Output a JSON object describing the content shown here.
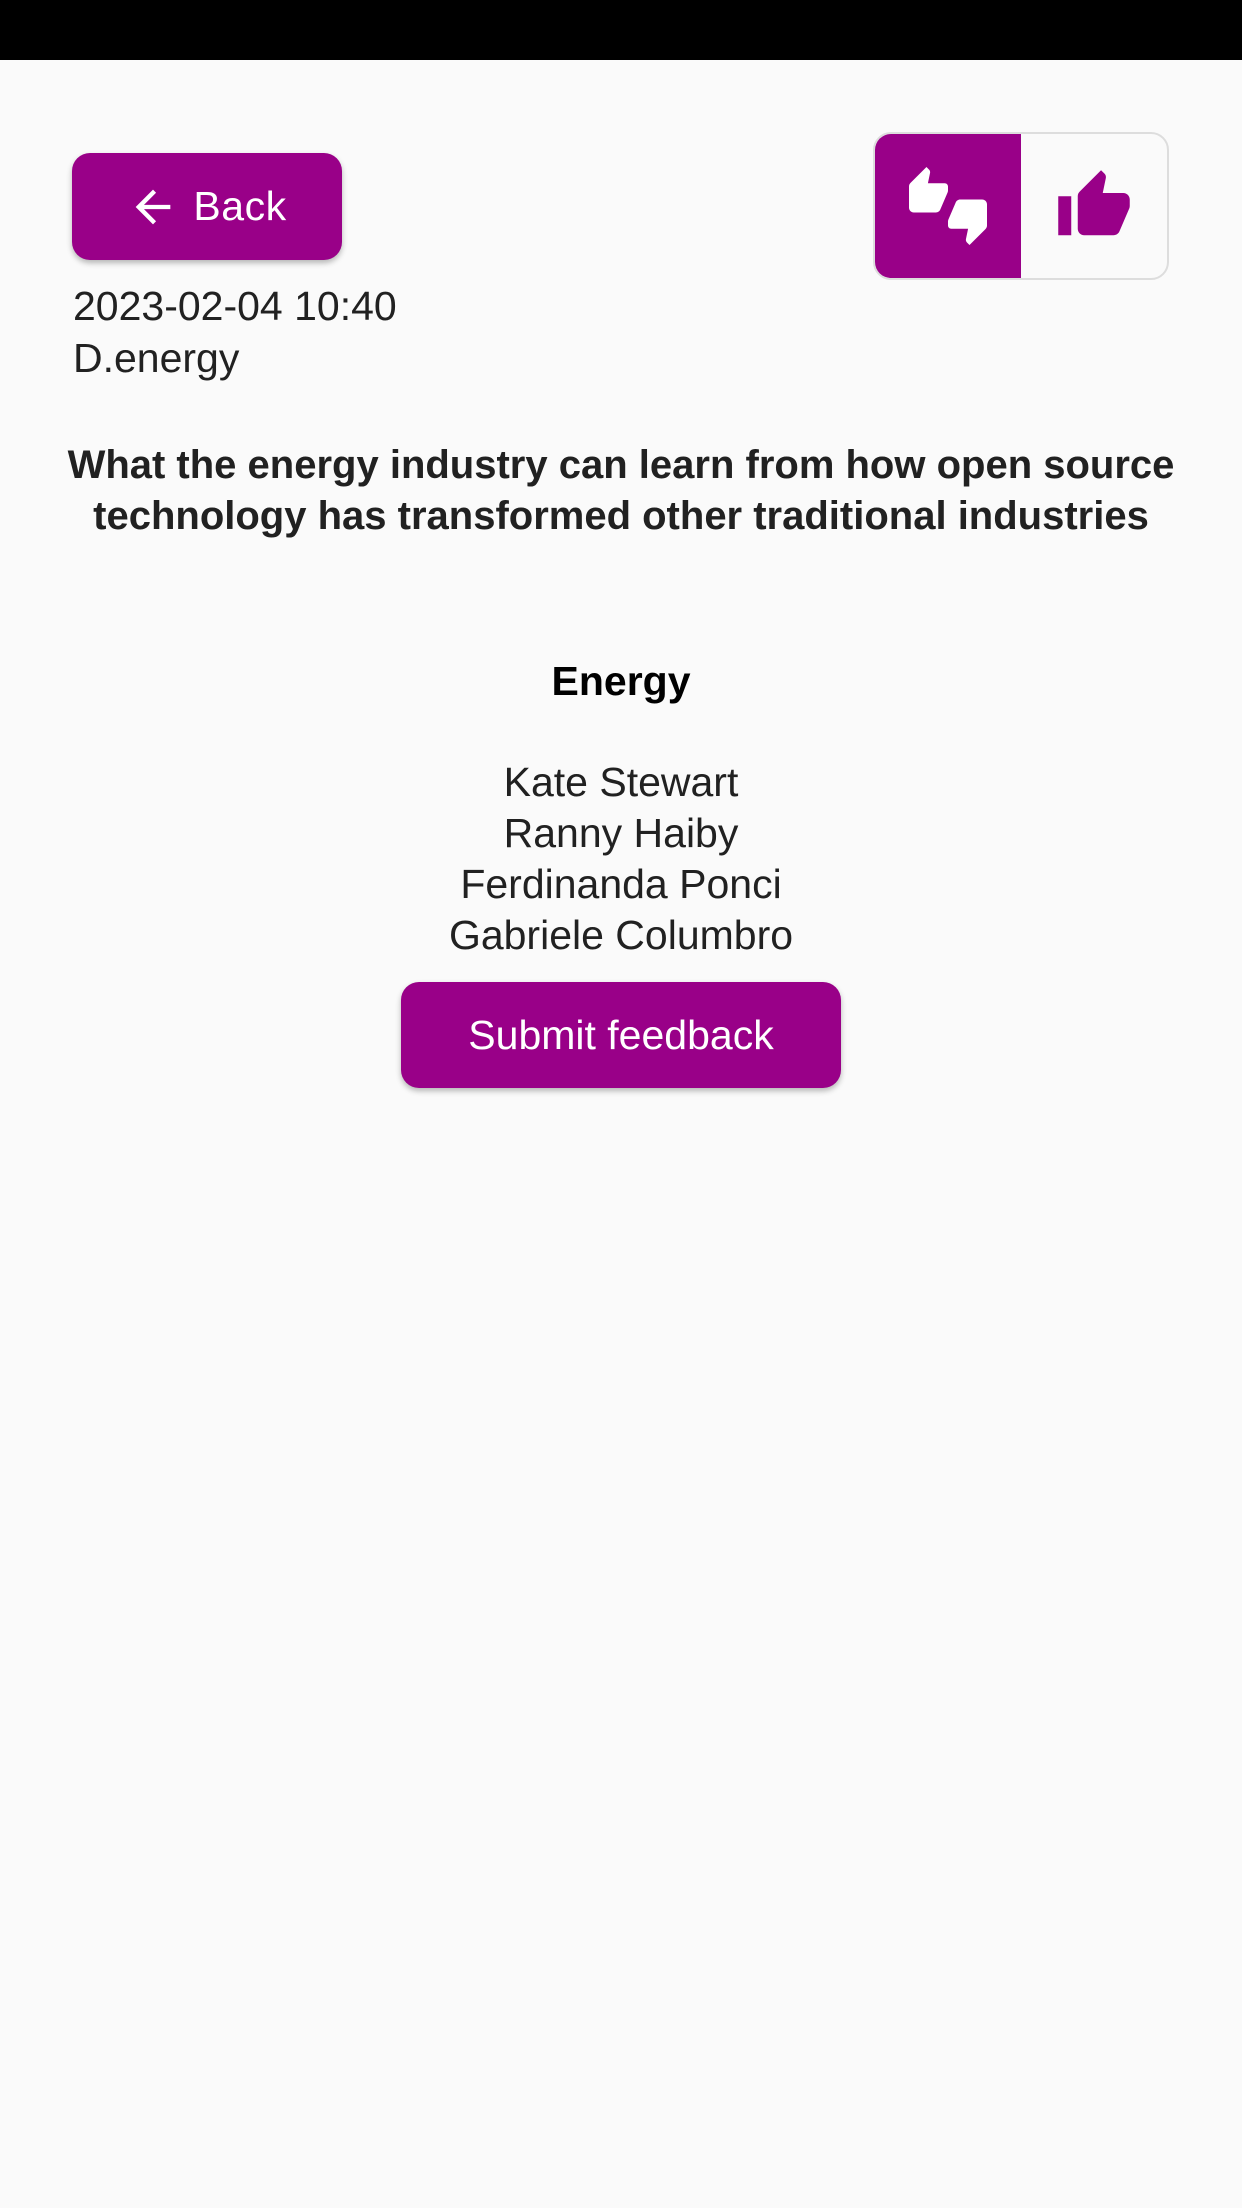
{
  "header": {
    "back_label": "Back"
  },
  "vote": {
    "options": [
      {
        "icon": "thumbs-up-down-icon",
        "selected": true
      },
      {
        "icon": "thumb-up-icon",
        "selected": false
      }
    ]
  },
  "talk": {
    "datetime": "2023-02-04 10:40",
    "room": "D.energy",
    "title": "What the energy industry can learn from how open source technology has transformed other traditional industries",
    "track": "Energy",
    "speakers": [
      "Kate Stewart",
      "Ranny Haiby",
      "Ferdinanda Ponci",
      "Gabriele Columbro"
    ]
  },
  "actions": {
    "submit_label": "Submit feedback"
  },
  "colors": {
    "accent": "#990088",
    "background": "#fafafa",
    "text": "#212121"
  }
}
